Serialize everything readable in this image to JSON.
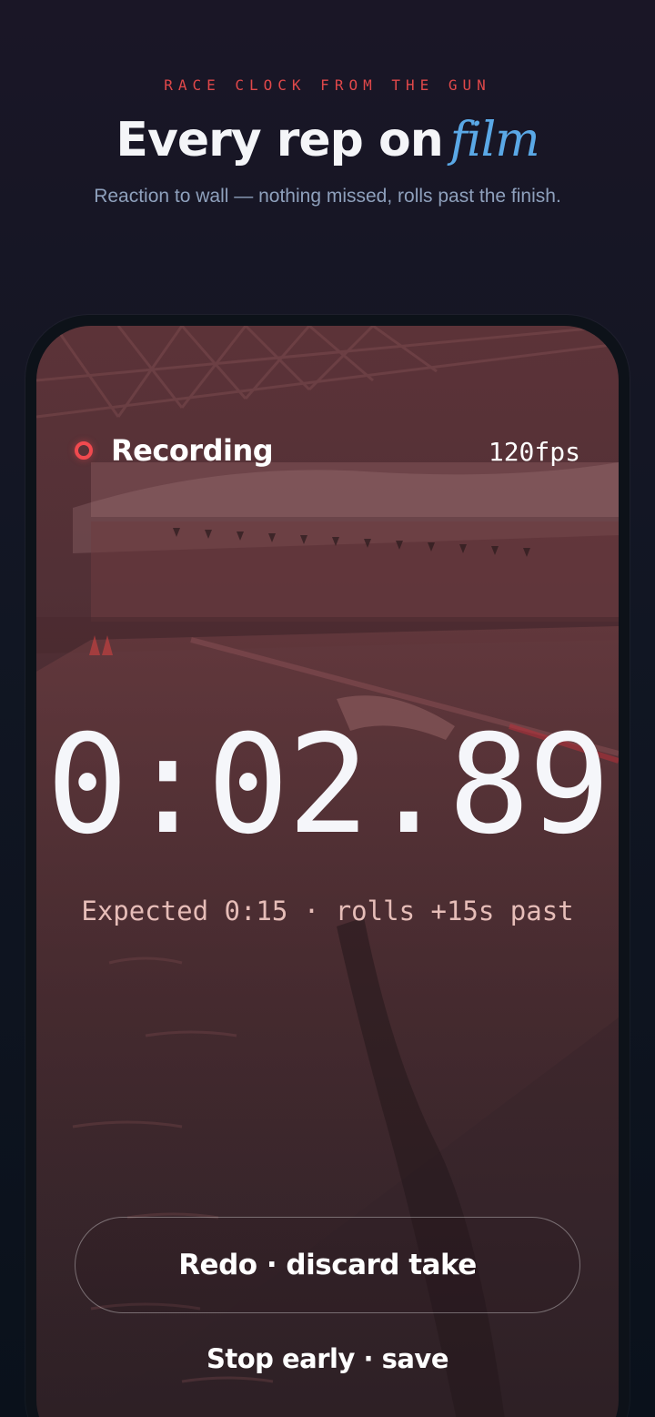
{
  "header": {
    "eyebrow": "RACE CLOCK FROM THE GUN",
    "title_main": "Every rep on",
    "title_accent": "film",
    "subtitle": "Reaction to wall — nothing missed, rolls past the finish."
  },
  "recorder": {
    "status_label": "Recording",
    "frame_rate": "120fps",
    "elapsed": "0:02.89",
    "expected_note": "Expected 0:15 · rolls +15s past",
    "redo_label": "Redo · discard take",
    "stop_label": "Stop early · save"
  },
  "colors": {
    "accent_red": "#f04a4f",
    "accent_blue": "#5aa8e6",
    "eyebrow_red": "#e0484a"
  }
}
